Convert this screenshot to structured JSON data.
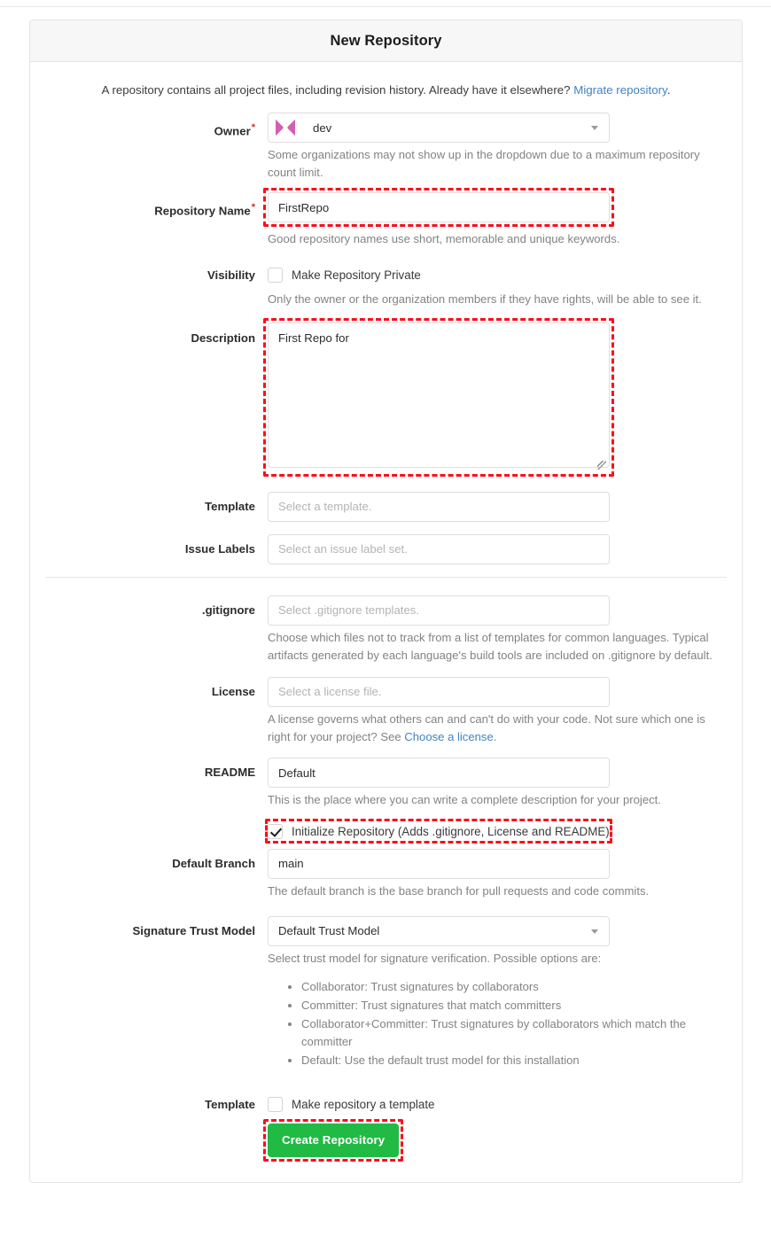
{
  "header": {
    "title": "New Repository"
  },
  "intro": {
    "text": "A repository contains all project files, including revision history. Already have it elsewhere? ",
    "link_label": "Migrate repository",
    "link_suffix": "."
  },
  "fields": {
    "owner": {
      "label": "Owner",
      "required_marker": "*",
      "value": "dev",
      "help": "Some organizations may not show up in the dropdown due to a maximum repository count limit."
    },
    "repository_name": {
      "label": "Repository Name",
      "required_marker": "*",
      "value": "FirstRepo",
      "help": "Good repository names use short, memorable and unique keywords."
    },
    "visibility": {
      "label": "Visibility",
      "checkbox_label": "Make Repository Private",
      "checked": false,
      "help": "Only the owner or the organization members if they have rights, will be able to see it."
    },
    "description": {
      "label": "Description",
      "value": "First Repo for"
    },
    "template_select": {
      "label": "Template",
      "placeholder": "Select a template."
    },
    "issue_labels": {
      "label": "Issue Labels",
      "placeholder": "Select an issue label set."
    },
    "gitignore": {
      "label": ".gitignore",
      "placeholder": "Select .gitignore templates.",
      "help": "Choose which files not to track from a list of templates for common languages. Typical artifacts generated by each language's build tools are included on .gitignore by default."
    },
    "license": {
      "label": "License",
      "placeholder": "Select a license file.",
      "help_prefix": "A license governs what others can and can't do with your code. Not sure which one is right for your project? See ",
      "help_link": "Choose a license",
      "help_suffix": "."
    },
    "readme": {
      "label": "README",
      "value": "Default",
      "help": "This is the place where you can write a complete description for your project."
    },
    "initialize": {
      "checkbox_label": "Initialize Repository (Adds .gitignore, License and README)",
      "checked": true
    },
    "default_branch": {
      "label": "Default Branch",
      "value": "main",
      "help": "The default branch is the base branch for pull requests and code commits."
    },
    "signature_trust_model": {
      "label": "Signature Trust Model",
      "value": "Default Trust Model",
      "help": "Select trust model for signature verification. Possible options are:",
      "bullets": [
        "Collaborator: Trust signatures by collaborators",
        "Committer: Trust signatures that match committers",
        "Collaborator+Committer: Trust signatures by collaborators which match the committer",
        "Default: Use the default trust model for this installation"
      ]
    },
    "make_template": {
      "label": "Template",
      "checkbox_label": "Make repository a template",
      "checked": false
    }
  },
  "actions": {
    "create_label": "Create Repository"
  },
  "colors": {
    "accent_green": "#21ba45",
    "link_blue": "#4183c4",
    "required_red": "#db2828",
    "highlight_red": "#fd0d1b",
    "avatar_pink": "#d45fb0"
  }
}
